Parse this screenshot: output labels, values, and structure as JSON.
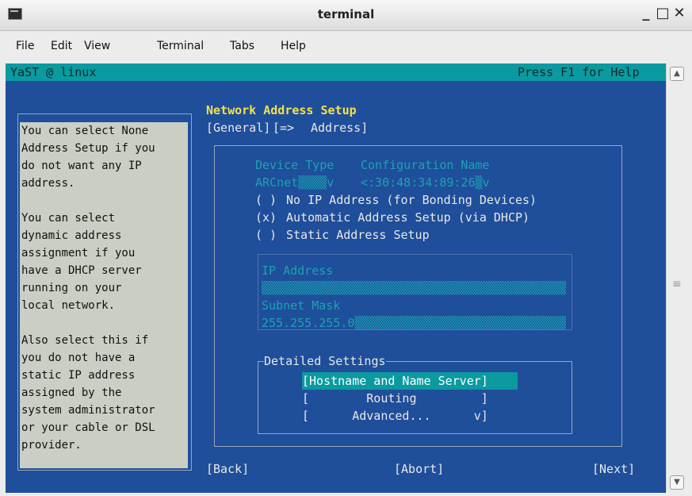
{
  "window": {
    "title": "terminal",
    "minimize": "_",
    "maximize": "□",
    "close": "✕"
  },
  "menu": [
    "File",
    "Edit",
    "View",
    "Terminal",
    "Tabs",
    "Help"
  ],
  "header": {
    "left": "YaST @ linux",
    "right": "Press F1 for Help"
  },
  "help_lines": [
    "You can select None",
    "Address Setup if you",
    "do not want any IP",
    "address.",
    "",
    "You can select",
    "dynamic address",
    "assignment if you",
    "have a DHCP server",
    "running on your",
    "local network.",
    "",
    "Also select this if",
    "you do not have a",
    "static IP address",
    "assigned by the",
    "system administrator",
    "or your cable or DSL",
    "provider."
  ],
  "dialog": {
    "title": "Network Address Setup",
    "tabs": {
      "general": "[General]",
      "separator": "[=>",
      "address": "Address]"
    },
    "device_type_label": "Device Type",
    "config_name_label": "Configuration Name",
    "device_type_value": "ARCnet▒▒▒▒v",
    "config_name_value": "<:30:48:34:89:26▒v",
    "options": [
      {
        "mark": "( )",
        "label": "No IP Address (for Bonding Devices)",
        "selected": false
      },
      {
        "mark": "(x)",
        "label": "Automatic Address Setup (via DHCP)",
        "selected": true
      },
      {
        "mark": "( )",
        "label": "Static Address Setup",
        "selected": false
      }
    ],
    "ip_label": "IP Address",
    "ip_value": "▒▒▒▒▒▒▒▒▒▒▒▒▒▒▒▒▒▒▒▒▒▒▒▒▒▒▒▒▒▒▒▒▒▒▒▒▒▒▒▒▒▒▒▒▒",
    "mask_label": "Subnet Mask",
    "mask_value": "255.255.255.0▒▒▒▒▒▒▒▒▒▒▒▒▒▒▒▒▒▒▒▒▒▒▒▒▒▒▒▒▒▒▒▒",
    "detailed_label": "Detailed Settings",
    "detailed_buttons": [
      "[Hostname and Name Server]",
      "[        Routing         ]",
      "[      Advanced...      v]"
    ],
    "back": "[Back]",
    "abort": "[Abort]",
    "next": "[Next]"
  }
}
